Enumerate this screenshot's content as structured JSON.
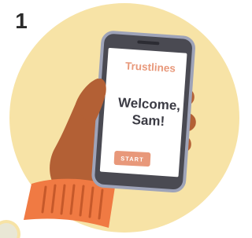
{
  "step": {
    "number": "1"
  },
  "phone": {
    "app_name": "Trustlines",
    "greeting_line1": "Welcome,",
    "greeting_line2": "Sam!",
    "start_label": "START"
  },
  "colors": {
    "background_circle": "#f7e3a6",
    "accent": "#e8987a",
    "hand": "#b36035",
    "sleeve": "#f07a43",
    "phone_frame": "#4a4a52",
    "phone_bezel": "#9ea3b8",
    "text_dark": "#3b3b44"
  }
}
